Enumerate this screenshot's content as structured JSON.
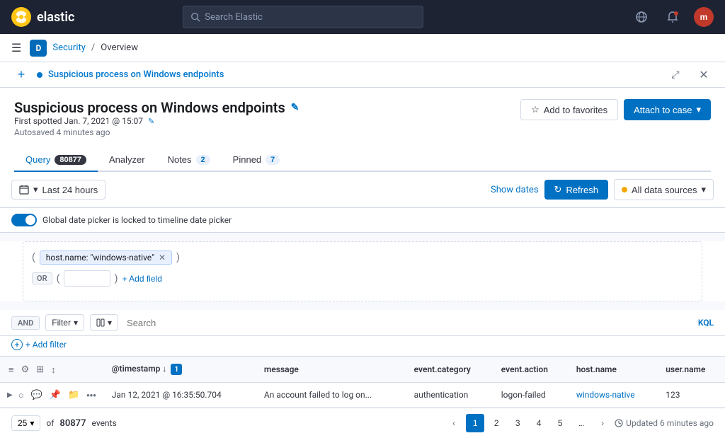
{
  "nav": {
    "logo_text": "elastic",
    "search_placeholder": "Search Elastic",
    "breadcrumb_letter": "D",
    "security_link": "Security",
    "overview_text": "Overview"
  },
  "alert": {
    "title": "Suspicious process on Windows endpoints",
    "dot_visible": true
  },
  "header": {
    "page_title": "Suspicious process on Windows endpoints",
    "first_spotted": "First spotted Jan. 7, 2021 @ 15:07",
    "autosaved": "Autosaved 4 minutes ago",
    "favorites_label": "Add to favorites",
    "attach_label": "Attach to case"
  },
  "tabs": [
    {
      "id": "query",
      "label": "Query",
      "badge": "80877",
      "badge_type": "dark",
      "active": true
    },
    {
      "id": "analyzer",
      "label": "Analyzer",
      "badge": null,
      "active": false
    },
    {
      "id": "notes",
      "label": "Notes",
      "badge": "2",
      "badge_type": "blue",
      "active": false
    },
    {
      "id": "pinned",
      "label": "Pinned",
      "badge": "7",
      "badge_type": "blue",
      "active": false
    }
  ],
  "toolbar": {
    "date_range": "Last 24 hours",
    "show_dates": "Show dates",
    "refresh_label": "Refresh",
    "all_data_sources": "All data sources"
  },
  "date_lock": {
    "message": "Global date picker is locked to timeline date picker"
  },
  "query": {
    "filter_tag": "host.name: \"windows-native\"",
    "add_field_label": "+ Add field",
    "or_label": "OR"
  },
  "filter_bar": {
    "and_label": "AND",
    "filter_label": "Filter",
    "search_placeholder": "Search",
    "kql_label": "KQL",
    "add_filter_label": "+ Add filter"
  },
  "table": {
    "col_header_icons": [
      "list-icon",
      "settings-icon",
      "columns-icon",
      "sort-icon"
    ],
    "columns": [
      {
        "id": "controls",
        "label": ""
      },
      {
        "id": "timestamp",
        "label": "@timestamp",
        "sortable": true,
        "sort_num": 1
      },
      {
        "id": "message",
        "label": "message"
      },
      {
        "id": "event_category",
        "label": "event.category"
      },
      {
        "id": "event_action",
        "label": "event.action"
      },
      {
        "id": "host_name",
        "label": "host.name"
      },
      {
        "id": "user_name",
        "label": "user.name"
      }
    ],
    "rows": [
      {
        "timestamp": "Jan 12, 2021 @ 16:35:50.704",
        "message": "An account failed to log on...",
        "event_category": "authentication",
        "event_action": "logon-failed",
        "host_name": "windows-native",
        "user_name": "123"
      }
    ]
  },
  "pagination": {
    "per_page": "25",
    "total": "80877",
    "events_label": "events",
    "current_page": 1,
    "pages": [
      "1",
      "2",
      "3",
      "4",
      "5",
      "..."
    ],
    "updated_label": "Updated 6 minutes ago"
  }
}
